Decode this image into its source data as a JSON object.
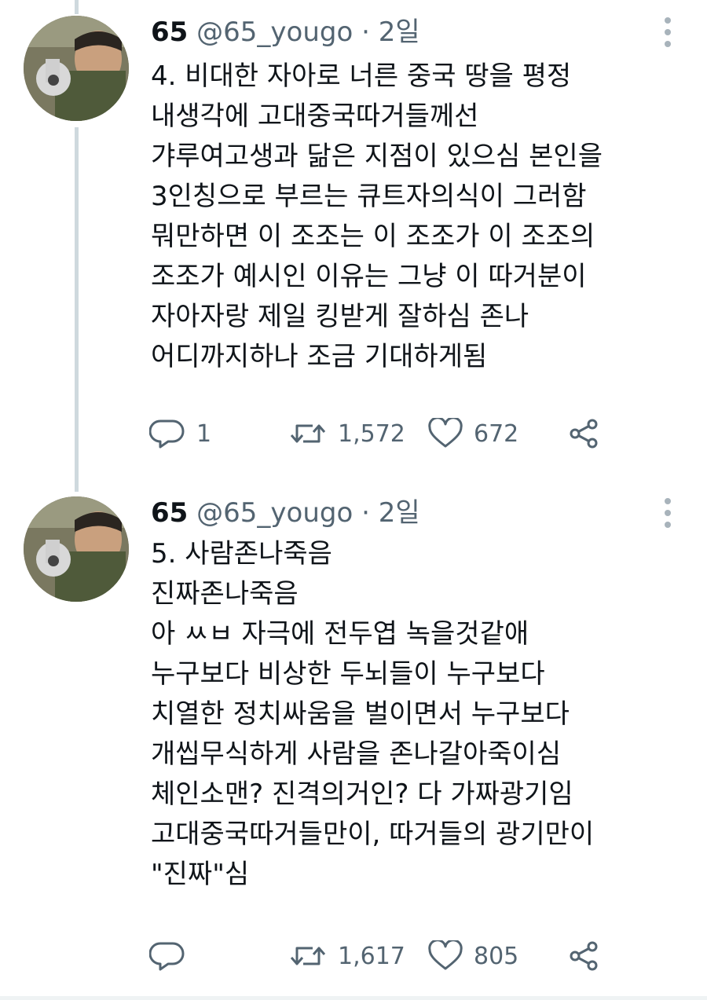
{
  "tweets": [
    {
      "author_name": "65",
      "author_handle": "@65_yougo",
      "separator": "·",
      "time": "2일",
      "lines": [
        "4. 비대한 자아로 너른 중국 땅을 평정",
        "내생각에 고대중국따거들께선",
        "갸루여고생과 닮은 지점이 있으심 본인을",
        "3인칭으로 부르는 큐트자의식이 그러함",
        "뭐만하면 이 조조는 이 조조가 이 조조의",
        "조조가 예시인 이유는 그냥 이 따거분이",
        "자아자랑 제일 킹받게 잘하심 존나",
        "어디까지하나 조금 기대하게됨"
      ],
      "reply_count": "1",
      "retweet_count": "1,572",
      "like_count": "672",
      "icons": [
        "reply-icon",
        "retweet-icon",
        "like-icon",
        "share-icon"
      ]
    },
    {
      "author_name": "65",
      "author_handle": "@65_yougo",
      "separator": "·",
      "time": "2일",
      "lines": [
        "5. 사람존나죽음",
        "진짜존나죽음",
        "아 ㅆㅂ 자극에 전두엽 녹을것같애",
        "누구보다 비상한 두뇌들이 누구보다",
        "치열한 정치싸움을 벌이면서 누구보다",
        "개씹무식하게 사람을 존나갈아죽이심",
        "체인소맨? 진격의거인? 다 가짜광기임",
        "고대중국따거들만이, 따거들의 광기만이",
        "\"진짜\"심"
      ],
      "reply_count": "",
      "retweet_count": "1,617",
      "like_count": "805",
      "icons": [
        "reply-icon",
        "retweet-icon",
        "like-icon",
        "share-icon"
      ]
    }
  ],
  "colors": {
    "text": "#0f1419",
    "secondary": "#536471",
    "thread_line": "#cfd9de",
    "more_dots": "#a8b3bb"
  }
}
